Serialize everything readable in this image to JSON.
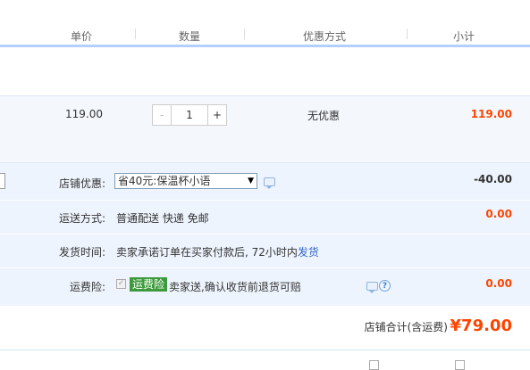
{
  "header": {
    "col_unit_price": "单价",
    "col_quantity": "数量",
    "col_discount": "优惠方式",
    "col_subtotal": "小计"
  },
  "item": {
    "unit_price": "119.00",
    "quantity": "1",
    "minus": "-",
    "plus": "+",
    "discount": "无优惠",
    "subtotal": "119.00"
  },
  "shop_discount": {
    "label": "店铺优惠:",
    "selected": "省40元:保温杯小语",
    "arrow": "▼",
    "amount": "-40.00"
  },
  "shipping": {
    "label": "运送方式:",
    "value": "普通配送 快递 免邮",
    "amount": "0.00"
  },
  "delivery": {
    "label": "发货时间:",
    "value_prefix": "卖家承诺订单在买家付款后, 72小时内",
    "value_link": "发货"
  },
  "insurance": {
    "label": "运费险:",
    "badge": "运费险",
    "value": "卖家送,确认收货前退货可赔",
    "help": "?",
    "amount": "0.00"
  },
  "total": {
    "label": "店铺合计(含运费)",
    "amount": "¥79.00"
  },
  "colors": {
    "accent_red": "#ff4400",
    "header_line": "#b2d1ff",
    "summary_bg": "#eef4fd",
    "badge_green": "#3c9a3c",
    "link_blue": "#3366cc"
  }
}
